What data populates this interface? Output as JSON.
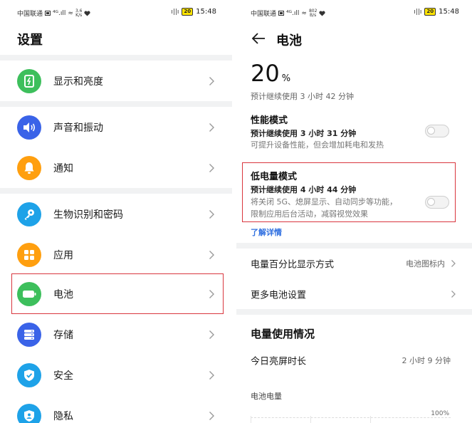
{
  "status_left": {
    "carrier": "中国联通",
    "signal": "⁴ᴳ.ıll",
    "wifi": "≈",
    "speed_top_left": "3.6",
    "speed_bottom_left": "K/s",
    "speed_top_right": "802",
    "speed_bottom_right": "B/s"
  },
  "status_right": {
    "vibrate": "ı||ı",
    "battery": "20",
    "time": "15:48"
  },
  "settings": {
    "title": "设置",
    "items": [
      {
        "id": "display",
        "label": "显示和亮度",
        "icon": "display-brightness-icon",
        "color": "#3dbf5c"
      },
      {
        "id": "sound",
        "label": "声音和振动",
        "icon": "speaker-icon",
        "color": "#3a63e8"
      },
      {
        "id": "notify",
        "label": "通知",
        "icon": "bell-icon",
        "color": "#ff9f0f"
      },
      {
        "id": "biometric",
        "label": "生物识别和密码",
        "icon": "key-icon",
        "color": "#1ea2e8"
      },
      {
        "id": "apps",
        "label": "应用",
        "icon": "apps-grid-icon",
        "color": "#ff9f0f"
      },
      {
        "id": "battery",
        "label": "电池",
        "icon": "battery-icon",
        "color": "#3dbf5c"
      },
      {
        "id": "storage",
        "label": "存储",
        "icon": "storage-icon",
        "color": "#3a63e8"
      },
      {
        "id": "security",
        "label": "安全",
        "icon": "shield-check-icon",
        "color": "#1ea2e8"
      },
      {
        "id": "privacy",
        "label": "隐私",
        "icon": "privacy-shield-icon",
        "color": "#1ea2e8"
      }
    ],
    "highlighted": "battery"
  },
  "battery": {
    "title": "电池",
    "level_value": "20",
    "level_unit": "%",
    "remaining": "预计继续使用 3 小时 42 分钟",
    "performance": {
      "title": "性能模式",
      "estimate": "预计继续使用 3 小时 31 分钟",
      "desc": "可提升设备性能，但会增加耗电和发热",
      "enabled": false
    },
    "low_power": {
      "title": "低电量模式",
      "estimate": "预计继续使用 4 小时 44 分钟",
      "desc_line1": "将关闭 5G、熄屏显示、自动同步等功能，",
      "desc_line2": "限制应用后台活动，减弱视觉效果",
      "enabled": false
    },
    "learn_more": "了解详情",
    "percent_display_label": "电量百分比显示方式",
    "percent_display_value": "电池图标内",
    "more_settings_label": "更多电池设置",
    "usage_title": "电量使用情况",
    "screen_on_label": "今日亮屏时长",
    "screen_on_value": "2 小时 9 分钟",
    "chart_label": "电池电量",
    "chart_max": "100%"
  },
  "colors": {
    "highlight": "#d9363e",
    "link": "#2f6fe0",
    "separator": "#f1f2f3"
  }
}
